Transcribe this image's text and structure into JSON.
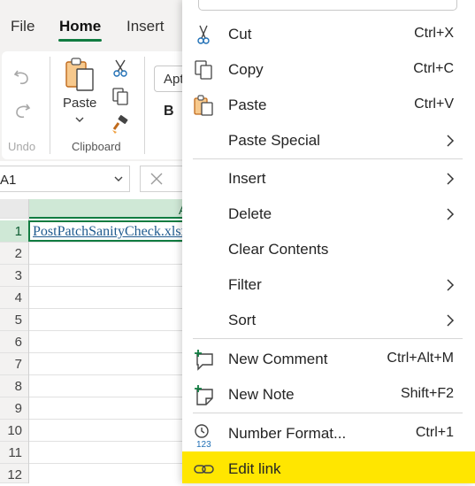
{
  "ribbon": {
    "tabs": [
      "File",
      "Home",
      "Insert"
    ],
    "active_tab": "Home",
    "font_name_partial": "Apt",
    "bold_label": "B",
    "paste_label": "Paste",
    "groups": {
      "undo": "Undo",
      "clipboard": "Clipboard"
    }
  },
  "formula_bar": {
    "name_box": "A1"
  },
  "sheet": {
    "rows": [
      "1",
      "2",
      "3",
      "4",
      "5",
      "6",
      "7",
      "8",
      "9",
      "10",
      "11",
      "12"
    ],
    "col_partial": "A",
    "cell_a1": "PostPatchSanityCheck.xlsx"
  },
  "context_menu": {
    "items": [
      {
        "label": "Cut",
        "shortcut": "Ctrl+X",
        "icon": "scissors-icon"
      },
      {
        "label": "Copy",
        "shortcut": "Ctrl+C",
        "icon": "copy-icon"
      },
      {
        "label": "Paste",
        "shortcut": "Ctrl+V",
        "icon": "paste-icon"
      },
      {
        "label": "Paste Special",
        "shortcut": "",
        "submenu": true
      },
      {
        "label": "Insert",
        "shortcut": "",
        "submenu": true
      },
      {
        "label": "Delete",
        "shortcut": "",
        "submenu": true
      },
      {
        "label": "Clear Contents",
        "shortcut": ""
      },
      {
        "label": "Filter",
        "shortcut": "",
        "submenu": true
      },
      {
        "label": "Sort",
        "shortcut": "",
        "submenu": true
      },
      {
        "label": "New Comment",
        "shortcut": "Ctrl+Alt+M",
        "icon": "new-comment-icon"
      },
      {
        "label": "New Note",
        "shortcut": "Shift+F2",
        "icon": "new-note-icon"
      },
      {
        "label": "Number Format...",
        "shortcut": "Ctrl+1",
        "icon": "number-format-icon"
      },
      {
        "label": "Edit link",
        "shortcut": "",
        "icon": "link-icon",
        "highlighted": true
      }
    ],
    "highlight_color": "#ffe600"
  },
  "colors": {
    "accent": "#107c41",
    "selection": "#cfe8d6"
  }
}
